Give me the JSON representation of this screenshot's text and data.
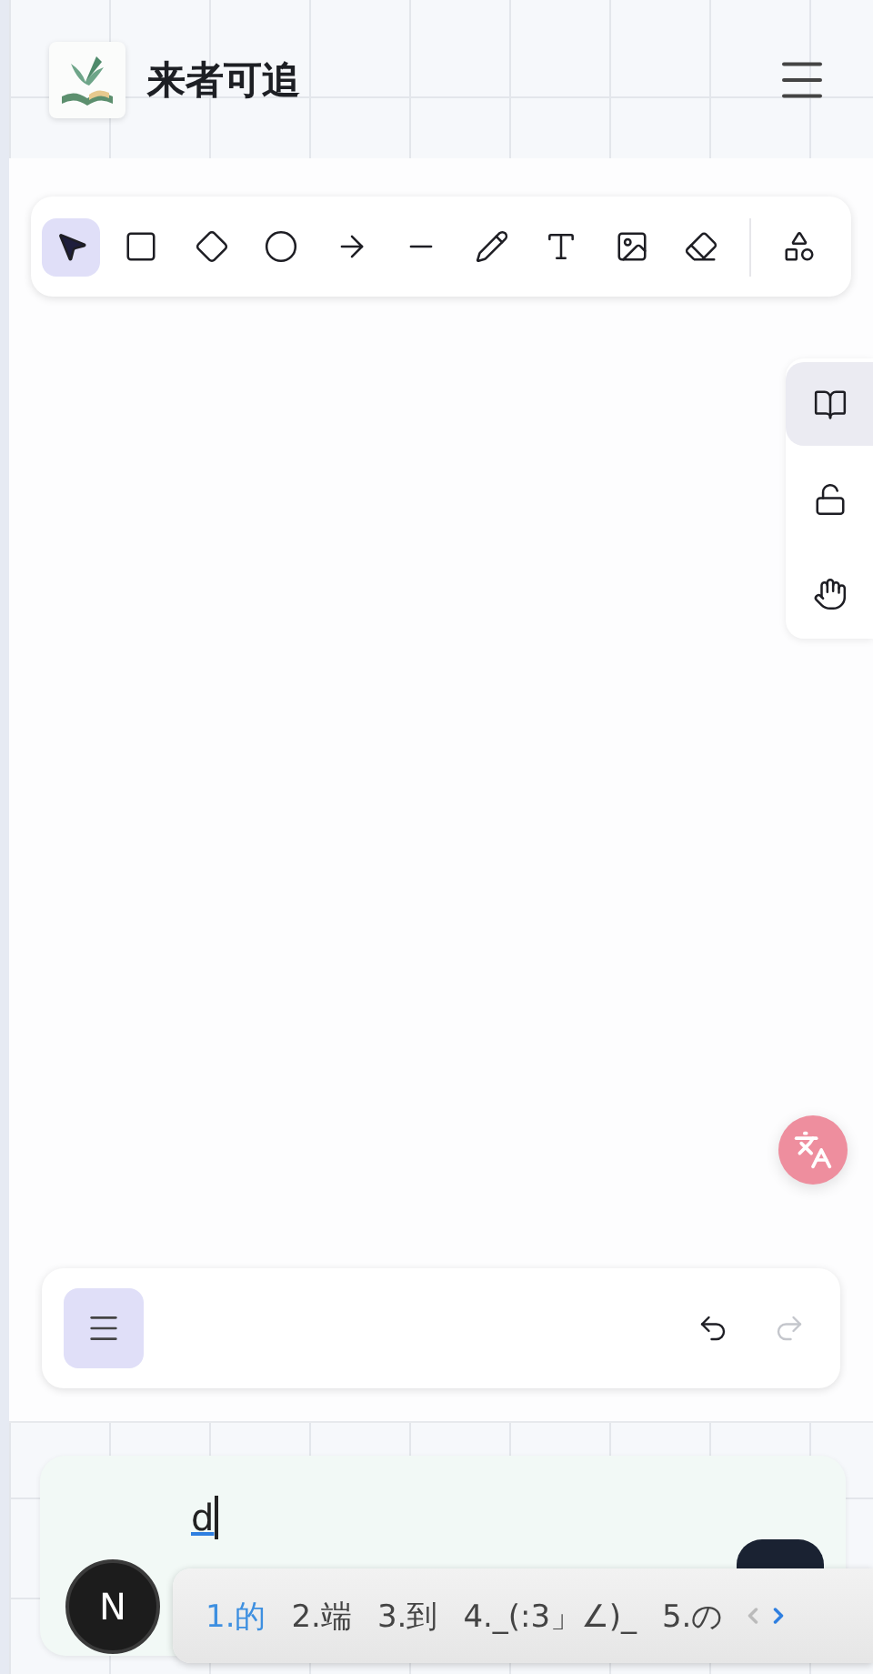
{
  "header": {
    "title": "来者可追"
  },
  "toolbar": {
    "tools": [
      {
        "kind": "select",
        "selected": true
      },
      {
        "kind": "rectangle",
        "selected": false
      },
      {
        "kind": "diamond",
        "selected": false
      },
      {
        "kind": "ellipse",
        "selected": false
      },
      {
        "kind": "arrow",
        "selected": false
      },
      {
        "kind": "line",
        "selected": false
      },
      {
        "kind": "draw",
        "selected": false
      },
      {
        "kind": "text",
        "selected": false
      },
      {
        "kind": "image",
        "selected": false
      },
      {
        "kind": "eraser",
        "selected": false
      },
      {
        "kind": "shapes",
        "selected": false
      }
    ]
  },
  "side_tools": [
    {
      "kind": "library",
      "selected": true
    },
    {
      "kind": "lock",
      "selected": false
    },
    {
      "kind": "hand",
      "selected": false
    }
  ],
  "bottom_bar": {
    "undo": {
      "disabled": false
    },
    "redo": {
      "disabled": true
    }
  },
  "input": {
    "value": "d",
    "avatar": "N"
  },
  "candidates": [
    {
      "label": "1.的",
      "selected": true
    },
    {
      "label": "2.端",
      "selected": false
    },
    {
      "label": "3.到",
      "selected": false
    },
    {
      "label": "4._(:3」∠)_",
      "selected": false
    },
    {
      "label": "5.の",
      "selected": false
    }
  ]
}
